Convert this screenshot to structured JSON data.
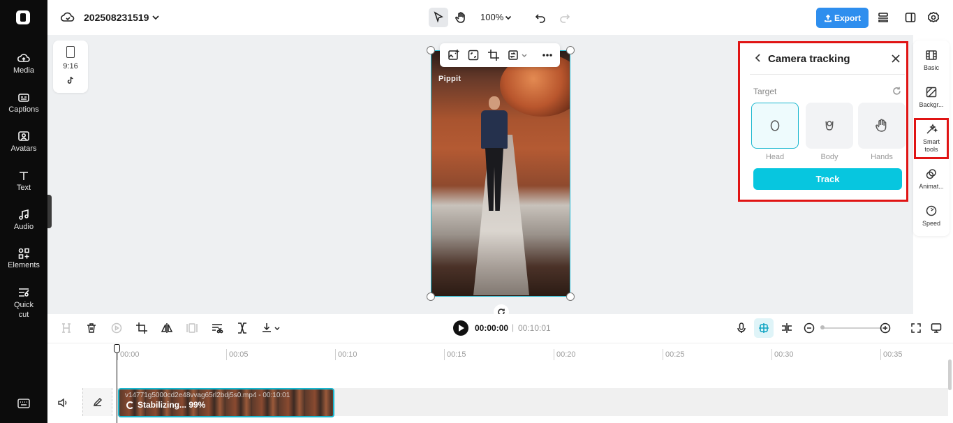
{
  "left_rail": {
    "items": [
      {
        "label": "Media",
        "icon": "media-icon"
      },
      {
        "label": "Captions",
        "icon": "captions-icon"
      },
      {
        "label": "Avatars",
        "icon": "avatars-icon"
      },
      {
        "label": "Text",
        "icon": "text-icon"
      },
      {
        "label": "Audio",
        "icon": "audio-icon"
      },
      {
        "label": "Elements",
        "icon": "elements-icon"
      },
      {
        "label": "Quick cut",
        "icon": "quick-cut-icon"
      }
    ]
  },
  "header": {
    "project_name": "202508231519",
    "zoom": "100%",
    "export_label": "Export"
  },
  "canvas": {
    "ratio_label": "9:16",
    "watermark": "Pippit"
  },
  "camera_tracking": {
    "title": "Camera tracking",
    "target_label": "Target",
    "options": [
      {
        "label": "Head",
        "selected": true,
        "icon": "head-icon"
      },
      {
        "label": "Body",
        "selected": false,
        "icon": "body-icon"
      },
      {
        "label": "Hands",
        "selected": false,
        "icon": "hand-icon"
      }
    ],
    "track_label": "Track"
  },
  "right_rail": {
    "items": [
      {
        "label": "Basic",
        "icon": "basic-icon"
      },
      {
        "label": "Backgr...",
        "icon": "background-icon"
      },
      {
        "label": "Smart tools",
        "icon": "magic-wand-icon",
        "highlighted": true
      },
      {
        "label": "Animat...",
        "icon": "animation-icon"
      },
      {
        "label": "Speed",
        "icon": "speed-icon"
      }
    ]
  },
  "playback": {
    "current_time": "00:00:00",
    "separator": "|",
    "total_time": "00:10:01"
  },
  "timeline": {
    "ruler": [
      "00:00",
      "00:05",
      "00:10",
      "00:15",
      "00:20",
      "00:25",
      "00:30",
      "00:35"
    ],
    "clip_name": "v14771g5000cd2e48vvag65rl2bdj5s0.mp4 - 00:10:01",
    "clip_status": "Stabilizing... 99%"
  },
  "colors": {
    "accent": "#07c6df",
    "export": "#2e8eee",
    "highlight_box": "#e01414"
  }
}
